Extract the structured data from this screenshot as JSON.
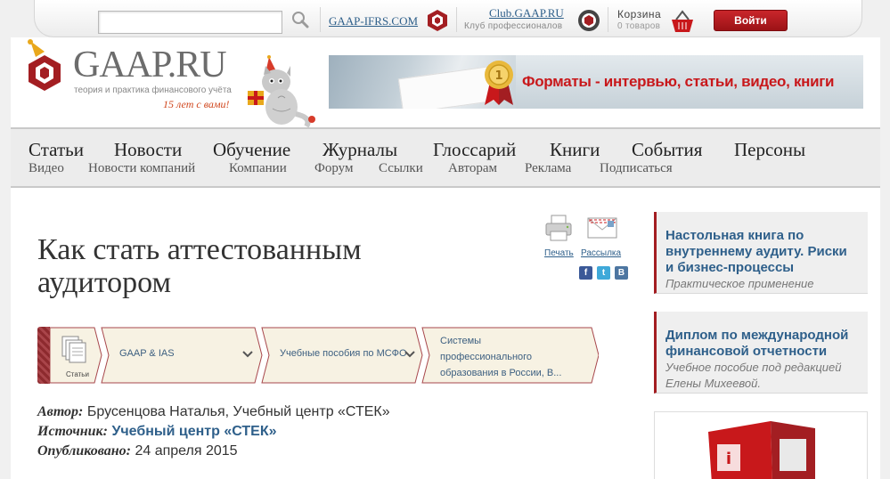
{
  "topbar": {
    "search_placeholder": "",
    "gaap_ifrs_link": "GAAP-IFRS.COM",
    "club_link": "Club.GAAP.RU",
    "club_sub": "Клуб профессионалов",
    "cart_label": "Корзина",
    "cart_count": "0 товаров",
    "login_label": "Войти"
  },
  "logo": {
    "text": "GAAP.RU",
    "tagline": "теория и практика финансового учёта",
    "years": "15 лет с вами!"
  },
  "banner": {
    "text": "Форматы - интервью, статьи, видео, книги"
  },
  "nav": {
    "main": [
      "Статьи",
      "Новости",
      "Обучение",
      "Журналы",
      "Глоссарий",
      "Книги",
      "События",
      "Персоны"
    ],
    "sub": [
      "Видео",
      "Новости компаний",
      "Компании",
      "Форум",
      "Ссылки",
      "Авторам",
      "Реклама",
      "Подписаться"
    ]
  },
  "article": {
    "title": "Как стать аттестованным аудитором",
    "tools": {
      "print": "Печать",
      "mailing": "Рассылка"
    },
    "social": [
      "f",
      "t",
      "В"
    ],
    "breadcrumbs": {
      "first_label": "Статьи",
      "items": [
        "GAAP & IAS",
        "Учебные пособия по МСФО",
        "Системы профессионального образования в России, В..."
      ]
    },
    "meta": {
      "author_label": "Автор:",
      "author": "Брусенцова Наталья, Учебный центр «СТЕК»",
      "source_label": "Источник:",
      "source": "Учебный центр «СТЕК»",
      "published_label": "Опубликовано:",
      "published": "24 апреля 2015"
    }
  },
  "sidebar": {
    "items": [
      {
        "title": "Настольная книга по внутреннему аудиту. Риски и бизнес-процессы",
        "subtitle": "Практическое применение"
      },
      {
        "title": "Диплом по международной финансовой отчетности",
        "subtitle": "Учебное пособие под редакцией Елены Михеевой."
      }
    ]
  },
  "colors": {
    "accent": "#a31e22",
    "link": "#2e5f8a",
    "banner_text": "#c8181b"
  }
}
